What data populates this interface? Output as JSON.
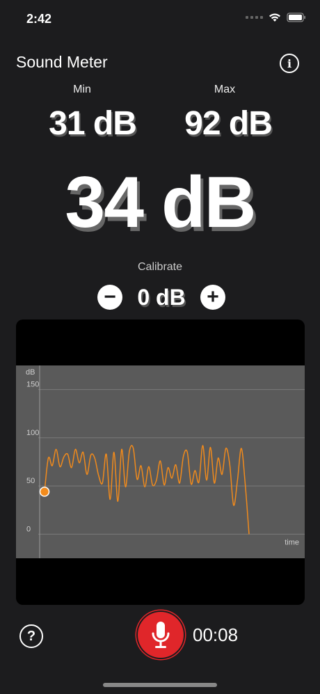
{
  "status_bar": {
    "time": "2:42"
  },
  "header": {
    "title": "Sound Meter",
    "info_icon": "info-icon"
  },
  "meter": {
    "min_label": "Min",
    "max_label": "Max",
    "min_value": "31 dB",
    "max_value": "92 dB",
    "current_value": "34 dB"
  },
  "calibrate": {
    "label": "Calibrate",
    "value": "0 dB",
    "minus_label": "−",
    "plus_label": "+"
  },
  "chart_data": {
    "type": "line",
    "ylabel": "dB",
    "xlabel": "time",
    "yticks": [
      0,
      50,
      100,
      150
    ],
    "ylim": [
      -25,
      175
    ],
    "grid": true,
    "line_color": "#f28b1c",
    "series": [
      {
        "values": [
          44,
          79,
          71,
          88,
          70,
          80,
          83,
          69,
          88,
          74,
          85,
          62,
          82,
          79,
          61,
          53,
          83,
          36,
          85,
          34,
          88,
          49,
          86,
          89,
          57,
          71,
          49,
          70,
          51,
          56,
          76,
          51,
          69,
          58,
          72,
          53,
          81,
          85,
          52,
          66,
          54,
          92,
          56,
          90,
          53,
          79,
          62,
          89,
          72,
          30,
          56,
          89,
          52,
          0
        ]
      }
    ],
    "current_marker": 44
  },
  "footer": {
    "help_label": "?",
    "timer": "00:08"
  },
  "colors": {
    "accent": "#f28b1c",
    "record": "#e0262a",
    "background": "#1c1c1e"
  }
}
